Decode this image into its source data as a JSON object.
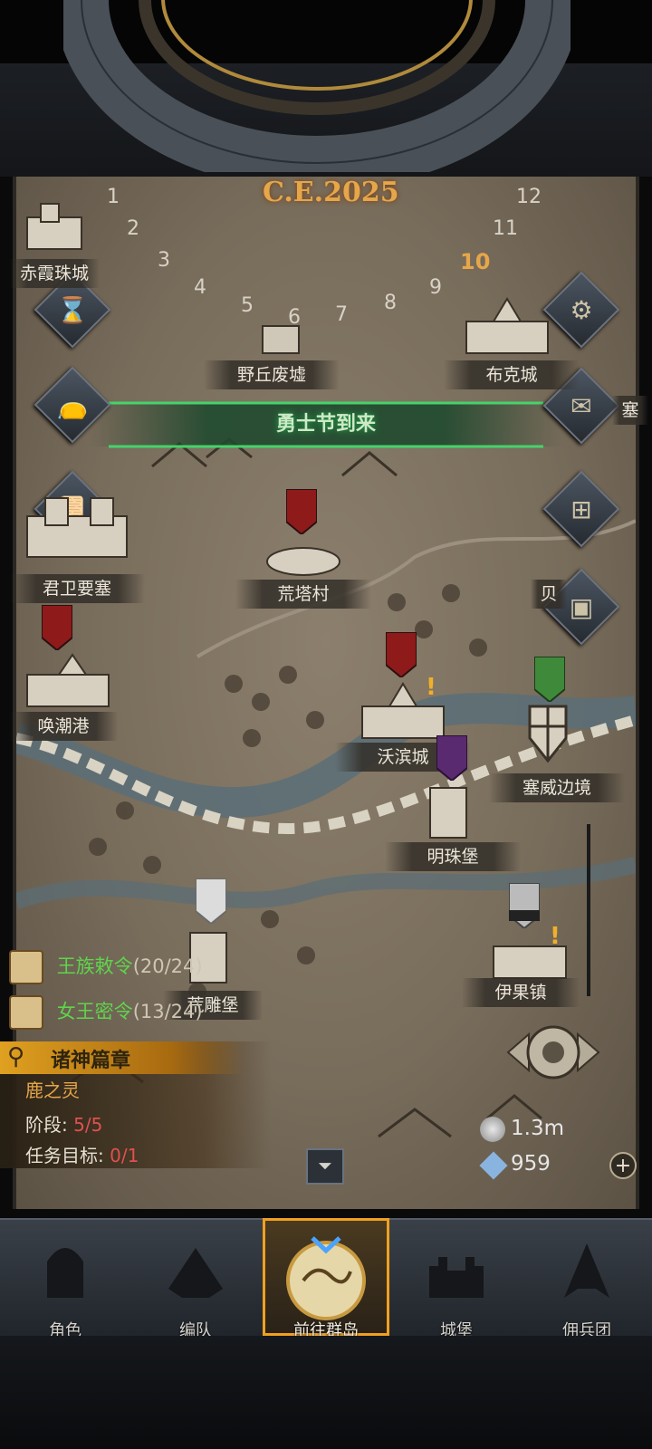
{
  "calendar": {
    "year": "C.E.2025",
    "months": [
      "1",
      "2",
      "3",
      "4",
      "5",
      "6",
      "7",
      "8",
      "9",
      "10",
      "11",
      "12"
    ],
    "current_month": "10"
  },
  "event_banner": "勇士节到来",
  "locations": {
    "chixia": "赤霞珠城",
    "yeqiu": "野丘废墟",
    "buke": "布克城",
    "sai": "塞",
    "junwei": "君卫要塞",
    "huangta": "荒塔村",
    "bei": "贝",
    "huanchao": "唤潮港",
    "wobin": "沃滨城",
    "saiwei": "塞威边境",
    "mingzhu": "明珠堡",
    "yiguo": "伊果镇",
    "huangdiao": "荒雕堡"
  },
  "quests": [
    {
      "name": "王族敕令",
      "count": "(20/24)"
    },
    {
      "name": "女王密令",
      "count": "(13/24)"
    }
  ],
  "quest_panel": {
    "title": "诸神篇章",
    "subtitle": "鹿之灵",
    "stage_label": "阶段:",
    "stage_value": "5/5",
    "goal_label": "任务目标:",
    "goal_value": "0/1"
  },
  "resources": {
    "silver": "1.3m",
    "gems": "959"
  },
  "nav": [
    {
      "label": "角色",
      "icon": "knight-helmet-icon"
    },
    {
      "label": "编队",
      "icon": "formation-icon"
    },
    {
      "label": "前往群岛",
      "icon": "island-compass-icon",
      "active": true
    },
    {
      "label": "城堡",
      "icon": "castle-icon"
    },
    {
      "label": "佣兵团",
      "icon": "mercenary-icon"
    }
  ],
  "colors": {
    "accent_gold": "#e6a64a",
    "quest_green": "#5fd44d",
    "stage_red": "#e05050",
    "nav_active": "#f0a020"
  }
}
